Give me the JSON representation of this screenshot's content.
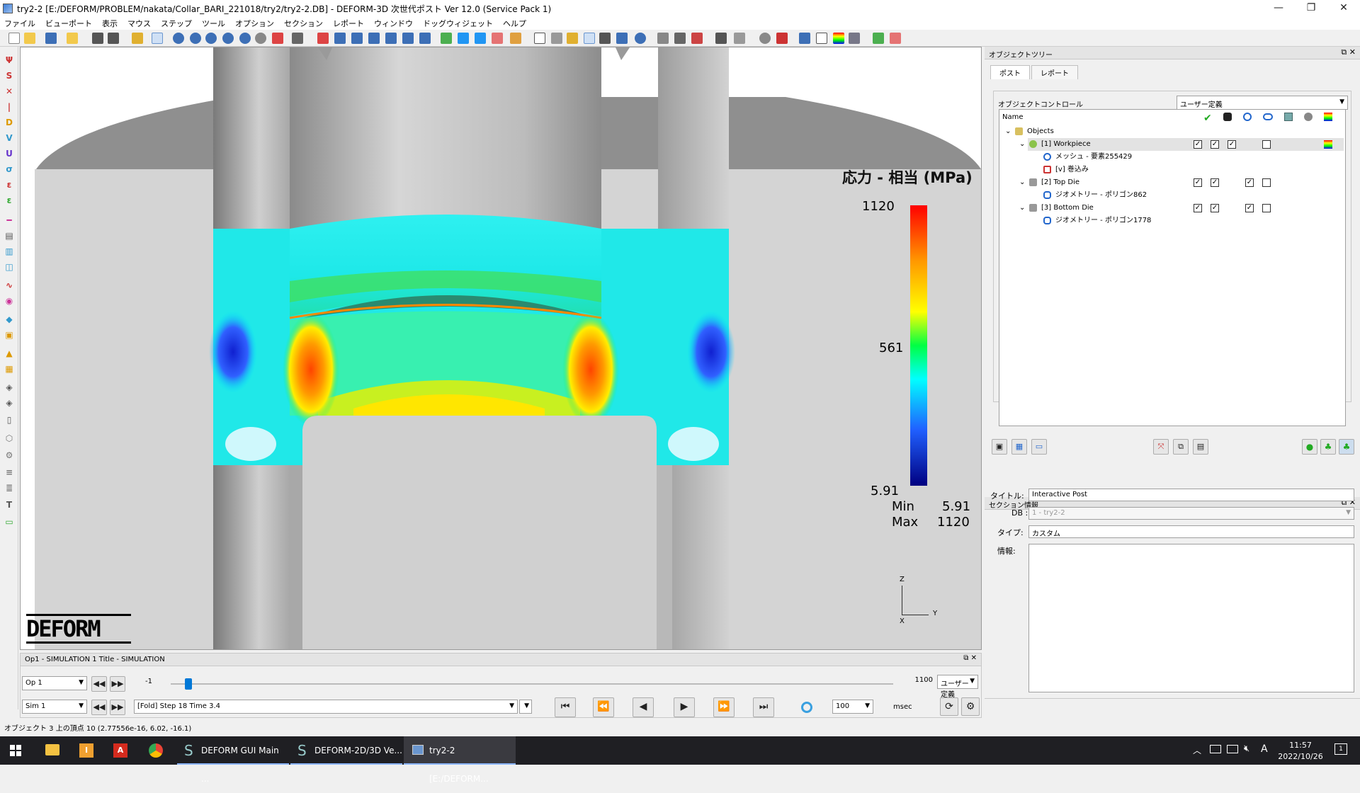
{
  "window": {
    "title": "try2-2 [E:/DEFORM/PROBLEM/nakata/Collar_BARI_221018/try2/try2-2.DB] - DEFORM-3D 次世代ポスト Ver 12.0 (Service Pack 1)",
    "minimize": "—",
    "maximize": "❐",
    "close": "✕"
  },
  "menu": [
    "ファイル",
    "ビューポート",
    "表示",
    "マウス",
    "ステップ",
    "ツール",
    "オプション",
    "セクション",
    "レポート",
    "ウィンドウ",
    "ドッグウィジェット",
    "ヘルプ"
  ],
  "viewport": {
    "legend_title": "応力 - 相当 (MPa)",
    "legend_max": "1120",
    "legend_mid": "561",
    "legend_min": "5.91",
    "min_label": "Min",
    "min_value": "5.91",
    "max_label": "Max",
    "max_value": "1120",
    "axis_z": "Z",
    "axis_y": "Y",
    "axis_x": "X",
    "logo": "DEFORM"
  },
  "anim": {
    "header": "Op1 - SIMULATION 1    Title - SIMULATION",
    "op_select": "Op 1",
    "sim_select": "Sim 1",
    "slider_start": "-1",
    "slider_end": "1100",
    "slider_value_fraction": 0.02,
    "mode_select": "ユーザー定義",
    "step_info": "[Fold]          Step   18     Time  3.4",
    "speed": "100",
    "unit": "msec"
  },
  "status_text": "オブジェクト 3 上の頂点 10 (2.77556e-16, 6.02, -16.1)",
  "object_tree": {
    "header": "オブジェクトツリー",
    "tabs": [
      "ポスト",
      "レポート"
    ],
    "control_label": "オブジェクトコントロール",
    "control_value": "ユーザー定義",
    "name_header": "Name",
    "rows": [
      {
        "label": "Objects",
        "indent": 0,
        "expand": "⌄",
        "icon": "objects-folder-icon",
        "checks": []
      },
      {
        "label": "[1] Workpiece",
        "indent": 1,
        "expand": "⌄",
        "icon": "workpiece-icon",
        "checks": [
          true,
          true,
          true,
          null,
          false
        ],
        "selected": true
      },
      {
        "label": "メッシュ - 要素255429",
        "indent": 2,
        "expand": "",
        "icon": "mesh-icon",
        "checks": []
      },
      {
        "label": "[v] 巻込み",
        "indent": 2,
        "expand": "",
        "icon": "fold-icon",
        "checks": []
      },
      {
        "label": "[2] Top Die",
        "indent": 1,
        "expand": "⌄",
        "icon": "die-icon",
        "checks": [
          true,
          true,
          null,
          true,
          false
        ]
      },
      {
        "label": "ジオメトリー - ポリゴン862",
        "indent": 2,
        "expand": "",
        "icon": "geometry-icon",
        "checks": []
      },
      {
        "label": "[3] Bottom Die",
        "indent": 1,
        "expand": "⌄",
        "icon": "die-icon",
        "checks": [
          true,
          true,
          null,
          true,
          false
        ]
      },
      {
        "label": "ジオメトリー - ポリゴン1778",
        "indent": 2,
        "expand": "",
        "icon": "geometry-icon",
        "checks": []
      }
    ]
  },
  "section_info": {
    "header": "セクション情報",
    "title_label": "タイトル:",
    "title_value": "Interactive Post",
    "db_label": "DB :",
    "db_value": "1 - try2-2",
    "type_label": "タイプ:",
    "type_value": "カスタム",
    "info_label": "情報:",
    "info_value": ""
  },
  "taskbar": {
    "apps": [
      "DEFORM GUI Main ...",
      "DEFORM-2D/3D Ve...",
      "try2-2 [E:/DEFORM..."
    ],
    "time": "11:57",
    "date": "2022/10/26",
    "ime": "A",
    "notif": "1"
  },
  "colors": {
    "accent": "#0078d7",
    "taskbar": "#1f1f23",
    "die_gray": "#bdbdbd"
  }
}
